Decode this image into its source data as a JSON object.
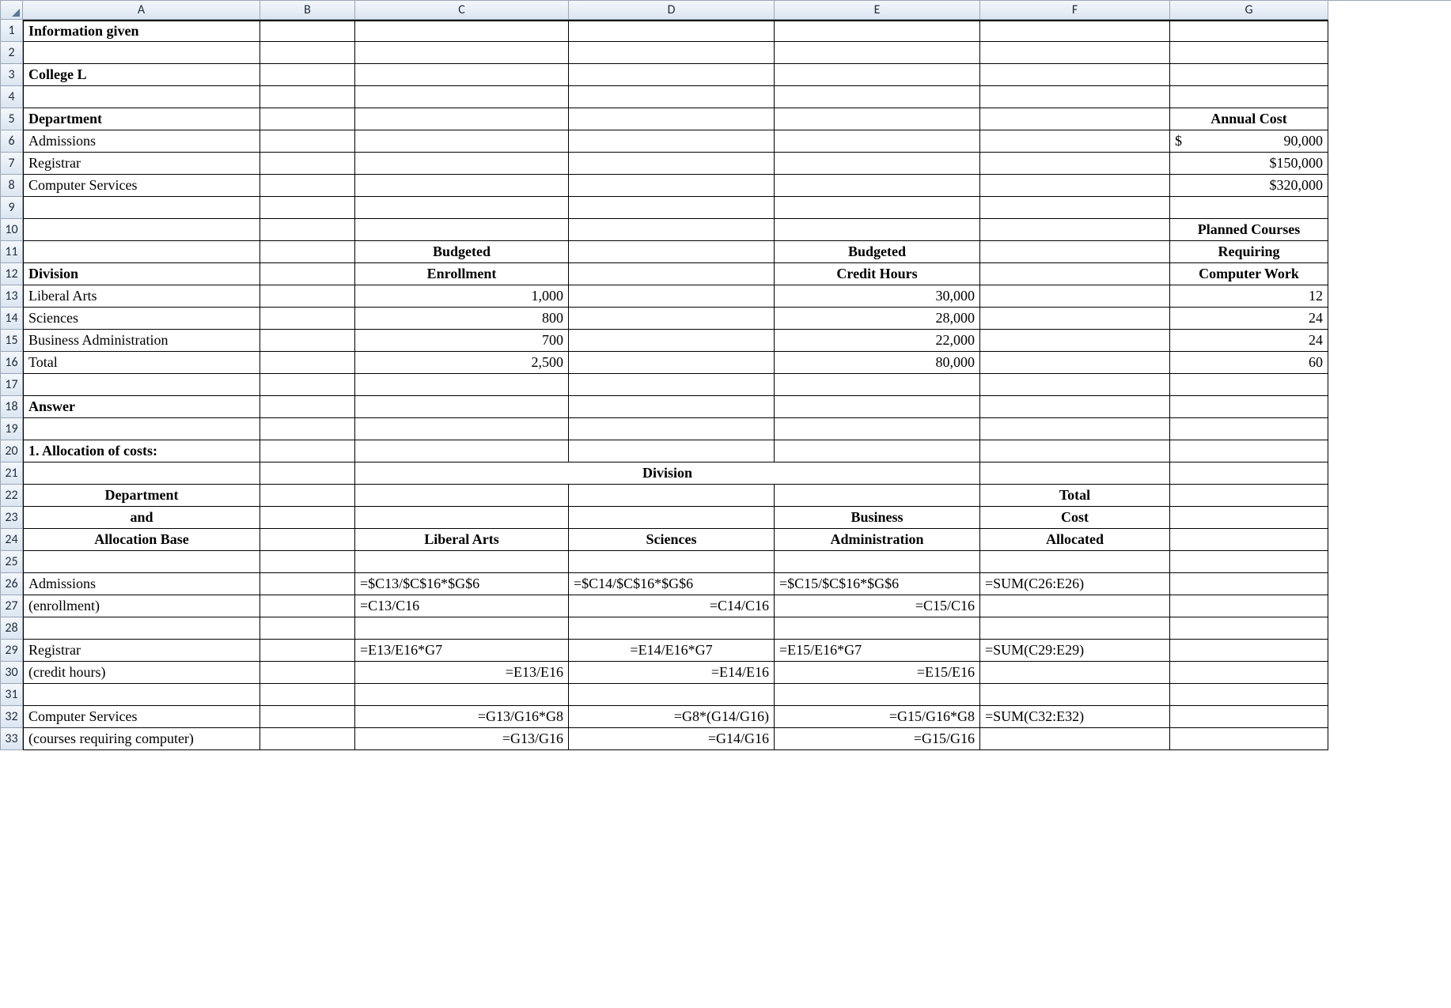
{
  "columns": [
    "A",
    "B",
    "C",
    "D",
    "E",
    "F",
    "G"
  ],
  "rownums": [
    "1",
    "2",
    "3",
    "4",
    "5",
    "6",
    "7",
    "8",
    "9",
    "10",
    "11",
    "12",
    "13",
    "14",
    "15",
    "16",
    "17",
    "18",
    "19",
    "20",
    "21",
    "22",
    "23",
    "24",
    "25",
    "26",
    "27",
    "28",
    "29",
    "30",
    "31",
    "32",
    "33"
  ],
  "r1": {
    "A": "Information given"
  },
  "r3": {
    "A": "College L"
  },
  "r5": {
    "A": "Department",
    "G": "Annual Cost"
  },
  "r6": {
    "A": "Admissions",
    "G_sym": "$",
    "G": "90,000"
  },
  "r7": {
    "A": "Registrar",
    "G": "$150,000"
  },
  "r8": {
    "A": "Computer Services",
    "G": "$320,000"
  },
  "r10": {
    "G": "Planned Courses"
  },
  "r11": {
    "C": "Budgeted",
    "E": "Budgeted",
    "G": "Requiring"
  },
  "r12": {
    "A": "Division",
    "C": "Enrollment",
    "E": "Credit Hours",
    "G": "Computer Work"
  },
  "r13": {
    "A": "Liberal Arts",
    "C": "1,000",
    "E": "30,000",
    "G": "12"
  },
  "r14": {
    "A": "Sciences",
    "C": "800",
    "E": "28,000",
    "G": "24"
  },
  "r15": {
    "A": "Business Administration",
    "C": "700",
    "E": "22,000",
    "G": "24"
  },
  "r16": {
    "A": " Total",
    "C": "2,500",
    "E": "80,000",
    "G": "60"
  },
  "r18": {
    "A": "Answer"
  },
  "r20": {
    "A": "1. Allocation of costs:"
  },
  "r21": {
    "CDE_merge": "Division"
  },
  "r22": {
    "A": "Department",
    "F": "Total"
  },
  "r23": {
    "A": "and",
    "E": "Business",
    "F": "Cost"
  },
  "r24": {
    "A": "Allocation Base",
    "C": "Liberal Arts",
    "D": "Sciences",
    "E": "Administration",
    "F": "Allocated"
  },
  "r26": {
    "A": "Admissions",
    "C": "=$C13/$C$16*$G$6",
    "D": "=$C14/$C$16*$G$6",
    "E": "=$C15/$C$16*$G$6",
    "F": "=SUM(C26:E26)"
  },
  "r27": {
    "A": "(enrollment)",
    "C": "=C13/C16",
    "D": "=C14/C16",
    "E": "=C15/C16"
  },
  "r29": {
    "A": "Registrar",
    "C": "=E13/E16*G7",
    "D": "=E14/E16*G7",
    "E": "=E15/E16*G7",
    "F": "=SUM(C29:E29)"
  },
  "r30": {
    "A": "(credit hours)",
    "C": "=E13/E16",
    "D": "=E14/E16",
    "E": "=E15/E16"
  },
  "r32": {
    "A": "Computer Services",
    "C": "=G13/G16*G8",
    "D": "=G8*(G14/G16)",
    "E": "=G15/G16*G8",
    "F": "=SUM(C32:E32)"
  },
  "r33": {
    "A": "(courses requiring computer)",
    "C": "=G13/G16",
    "D": "=G14/G16",
    "E": "=G15/G16"
  },
  "chart_data": {
    "type": "table",
    "title": "Information given / College L — cost allocation worksheet",
    "annual_cost": {
      "Admissions": 90000,
      "Registrar": 150000,
      "Computer Services": 320000
    },
    "divisions": {
      "categories": [
        "Liberal Arts",
        "Sciences",
        "Business Administration",
        "Total"
      ],
      "budgeted_enrollment": [
        1000,
        800,
        700,
        2500
      ],
      "budgeted_credit_hours": [
        30000,
        28000,
        22000,
        80000
      ],
      "planned_courses_requiring_computer_work": [
        12,
        24,
        24,
        60
      ]
    },
    "allocation_formulas": {
      "Admissions (enrollment)": {
        "Liberal Arts": "=$C13/$C$16*$G$6",
        "Sciences": "=$C14/$C$16*$G$6",
        "Business Administration": "=$C15/$C$16*$G$6",
        "Total Cost Allocated": "=SUM(C26:E26)",
        "ratios": {
          "Liberal Arts": "=C13/C16",
          "Sciences": "=C14/C16",
          "Business Administration": "=C15/C16"
        }
      },
      "Registrar (credit hours)": {
        "Liberal Arts": "=E13/E16*G7",
        "Sciences": "=E14/E16*G7",
        "Business Administration": "=E15/E16*G7",
        "Total Cost Allocated": "=SUM(C29:E29)",
        "ratios": {
          "Liberal Arts": "=E13/E16",
          "Sciences": "=E14/E16",
          "Business Administration": "=E15/E16"
        }
      },
      "Computer Services (courses requiring computer)": {
        "Liberal Arts": "=G13/G16*G8",
        "Sciences": "=G8*(G14/G16)",
        "Business Administration": "=G15/G16*G8",
        "Total Cost Allocated": "=SUM(C32:E32)",
        "ratios": {
          "Liberal Arts": "=G13/G16",
          "Sciences": "=G14/G16",
          "Business Administration": "=G15/G16"
        }
      }
    }
  }
}
